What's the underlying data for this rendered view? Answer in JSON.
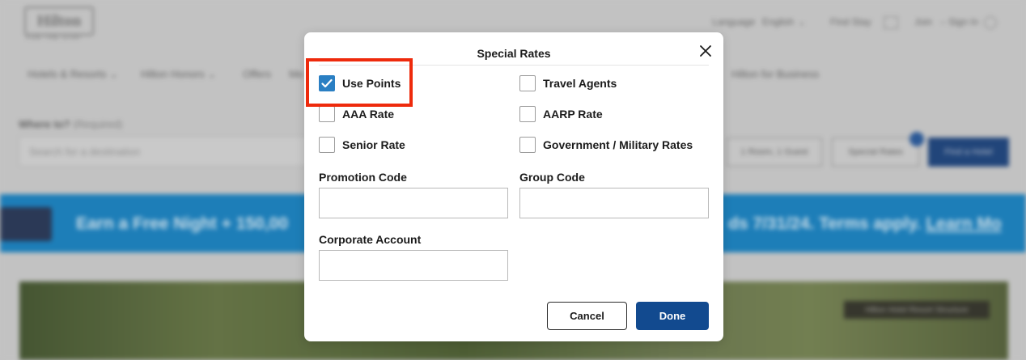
{
  "background": {
    "logo": "Hilton",
    "logo_tagline": "FOR THE STAY",
    "top_links": {
      "language_label": "Language",
      "language_value": "English",
      "find_stay": "Find Stay",
      "join": "Join",
      "sign_in": "Sign In"
    },
    "nav": [
      "Hotels & Resorts",
      "Hilton Honors",
      "Offers",
      "Me",
      "Hilton for Business"
    ],
    "where_label": "Where to?",
    "where_required": "(Required)",
    "search_placeholder": "Search for a destination",
    "rooms_guests": "1 Room, 1 Guest",
    "special_rates_button": "Special Rates",
    "find_hotel_button": "Find a Hotel",
    "promo_left": "Earn a Free Night + 150,00",
    "promo_right": "ds 7/31/24. Terms apply.",
    "promo_link": "Learn Mo",
    "hero_tag": "Hilton Hotel Resort Structure"
  },
  "modal": {
    "title": "Special Rates",
    "close_icon": "close-icon",
    "checkboxes": [
      {
        "label": "Use Points",
        "checked": true
      },
      {
        "label": "Travel Agents",
        "checked": false
      },
      {
        "label": "AAA Rate",
        "checked": false
      },
      {
        "label": "AARP Rate",
        "checked": false
      },
      {
        "label": "Senior Rate",
        "checked": false
      },
      {
        "label": "Government / Military Rates",
        "checked": false
      }
    ],
    "fields": {
      "promotion_code": {
        "label": "Promotion Code",
        "value": ""
      },
      "group_code": {
        "label": "Group Code",
        "value": ""
      },
      "corporate_account": {
        "label": "Corporate Account",
        "value": ""
      }
    },
    "cancel_label": "Cancel",
    "done_label": "Done"
  },
  "colors": {
    "checkbox_checked": "#2a7fc3",
    "done_button": "#124a8f",
    "highlight": "#ee2a0c",
    "promo_banner": "#1f86c4"
  }
}
